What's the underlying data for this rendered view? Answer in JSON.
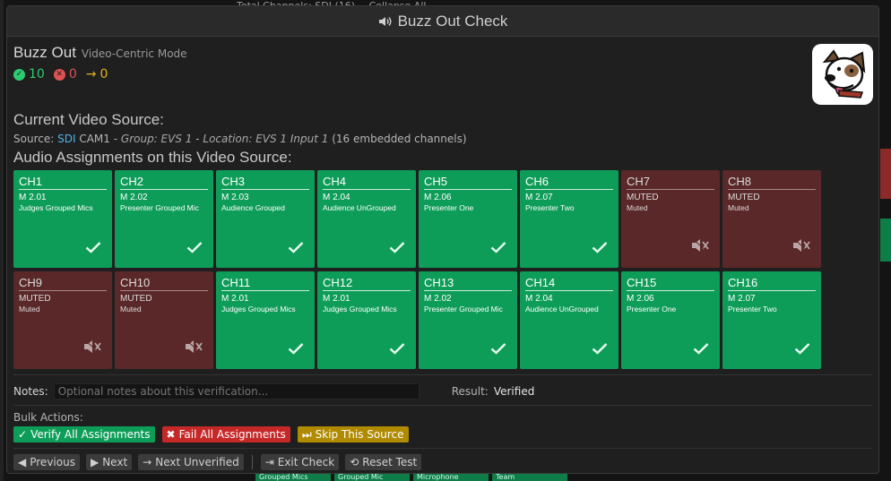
{
  "background": {
    "top_strip": [
      "Total Channels: SDI (16)",
      "Collapse All"
    ],
    "bottom_cells": [
      "Grouped Mics",
      "Grouped Mic",
      "Microphone",
      "Team"
    ]
  },
  "modal": {
    "title": "Buzz Out Check",
    "heading": "Buzz Out",
    "mode": "Video-Centric Mode",
    "counts": {
      "verified": "10",
      "failed": "0",
      "skipped": "0"
    },
    "current_source_heading": "Current Video Source:",
    "source": {
      "label": "Source:",
      "type": "SDI",
      "name": "CAM1",
      "group": "Group: EVS 1",
      "location": "Location: EVS 1 Input 1",
      "channels": "(16 embedded channels)"
    },
    "assignments_heading": "Audio Assignments on this Video Source:",
    "channels": [
      {
        "ch": "CH1",
        "m": "M 2.01",
        "d": "Judges Grouped Mics",
        "status": "ok"
      },
      {
        "ch": "CH2",
        "m": "M 2.02",
        "d": "Presenter Grouped Mic",
        "status": "ok"
      },
      {
        "ch": "CH3",
        "m": "M 2.03",
        "d": "Audience Grouped",
        "status": "ok"
      },
      {
        "ch": "CH4",
        "m": "M 2.04",
        "d": "Audience UnGrouped",
        "status": "ok"
      },
      {
        "ch": "CH5",
        "m": "M 2.06",
        "d": "Presenter One",
        "status": "ok"
      },
      {
        "ch": "CH6",
        "m": "M 2.07",
        "d": "Presenter Two",
        "status": "ok"
      },
      {
        "ch": "CH7",
        "m": "MUTED",
        "d": "Muted",
        "status": "muted"
      },
      {
        "ch": "CH8",
        "m": "MUTED",
        "d": "Muted",
        "status": "muted"
      },
      {
        "ch": "CH9",
        "m": "MUTED",
        "d": "Muted",
        "status": "muted"
      },
      {
        "ch": "CH10",
        "m": "MUTED",
        "d": "Muted",
        "status": "muted"
      },
      {
        "ch": "CH11",
        "m": "M 2.01",
        "d": "Judges Grouped Mics",
        "status": "ok"
      },
      {
        "ch": "CH12",
        "m": "M 2.01",
        "d": "Judges Grouped Mics",
        "status": "ok"
      },
      {
        "ch": "CH13",
        "m": "M 2.02",
        "d": "Presenter Grouped Mic",
        "status": "ok"
      },
      {
        "ch": "CH14",
        "m": "M 2.04",
        "d": "Audience UnGrouped",
        "status": "ok"
      },
      {
        "ch": "CH15",
        "m": "M 2.06",
        "d": "Presenter One",
        "status": "ok"
      },
      {
        "ch": "CH16",
        "m": "M 2.07",
        "d": "Presenter Two",
        "status": "ok"
      }
    ],
    "notes": {
      "label": "Notes:",
      "placeholder": "Optional notes about this verification..."
    },
    "result": {
      "label": "Result:",
      "value": "Verified"
    },
    "bulk": {
      "label": "Bulk Actions:",
      "verify_all": "Verify All Assignments",
      "fail_all": "Fail All Assignments",
      "skip_source": "Skip This Source"
    },
    "nav": {
      "previous": "Previous",
      "next": "Next",
      "next_unverified": "Next Unverified",
      "exit": "Exit Check",
      "reset": "Reset Test"
    }
  },
  "colors": {
    "ok": "#0e9d58",
    "muted": "#5a2828",
    "fail": "#c62828",
    "skip": "#b08a00"
  }
}
